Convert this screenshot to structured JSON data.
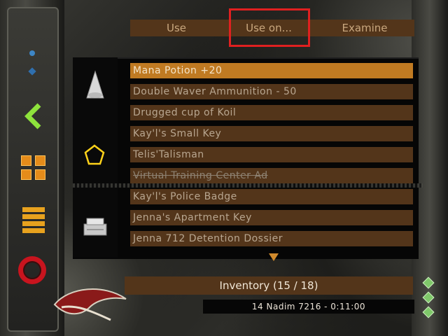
{
  "menu": {
    "tabs": [
      {
        "label": "Use"
      },
      {
        "label": "Use on..."
      },
      {
        "label": "Examine"
      }
    ]
  },
  "inventory": {
    "items": [
      {
        "label": "Mana Potion +20",
        "selected": true
      },
      {
        "label": "Double Waver Ammunition - 50"
      },
      {
        "label": "Drugged cup of Koil"
      },
      {
        "label": "Kay'l's Small Key"
      },
      {
        "label": "Telis'Talisman"
      },
      {
        "label": "Virtual Training Center Ad",
        "strikethrough": true
      },
      {
        "label": "Kay'l's Police Badge"
      },
      {
        "label": "Jenna's Apartment Key"
      },
      {
        "label": "Jenna 712 Detention Dossier"
      }
    ],
    "title": "Inventory  (15 / 18)",
    "datetime": "14 Nadim 7216 - 0:11:00"
  },
  "icons": {
    "item_icons": [
      "flask-icon",
      "pentagon-talisman-icon",
      "badge-printer-icon"
    ],
    "left_controls": [
      "blue-dot-icon",
      "back-chevron-icon",
      "grid-view-icon",
      "list-view-icon",
      "ring-icon"
    ],
    "scroll": "scroll-down-arrow-icon"
  },
  "colors": {
    "row": "#53351a",
    "row_selected": "#c07a22",
    "text": "#b8a690",
    "accent_red": "#e02020",
    "chevron": "#8ee23c",
    "orange": "#e58c1a"
  }
}
